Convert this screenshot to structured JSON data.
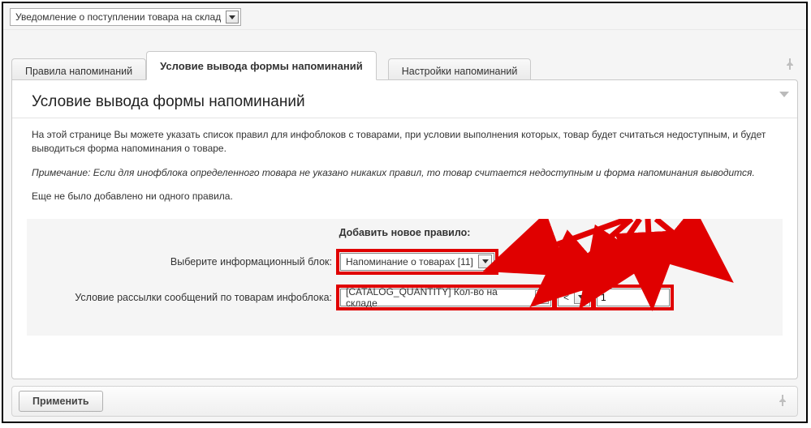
{
  "top_select": {
    "value": "Уведомление о поступлении товара на склад"
  },
  "tabs": {
    "rules": "Правила напоминаний",
    "condition": "Условие вывода формы напоминаний",
    "settings": "Настройки напоминаний"
  },
  "panel": {
    "title": "Условие вывода формы напоминаний",
    "desc_line1": "На этой странице Вы можете указать список правил для инфоблоков с товарами, при условии выполнения которых, товар будет считаться недоступным, и будет выводиться форма напоминания о товаре.",
    "desc_note": "Примечание: Если для инофблока определенного товара не указано никаких правил, то товар считается недоступным и форма напоминания выводится.",
    "desc_empty": "Еще не было добавлено ни одного правила."
  },
  "add_rule": {
    "heading": "Добавить новое правило:",
    "label_block": "Выберите информационный блок:",
    "select_block_value": "Напоминание о товарах [11]",
    "label_condition": "Условие рассылки сообщений по товарам инфоблока:",
    "select_field_value": "[CATALOG_QUANTITY] Кол-во на складе",
    "select_op_value": "<",
    "input_value": "1"
  },
  "buttons": {
    "apply": "Применить"
  }
}
